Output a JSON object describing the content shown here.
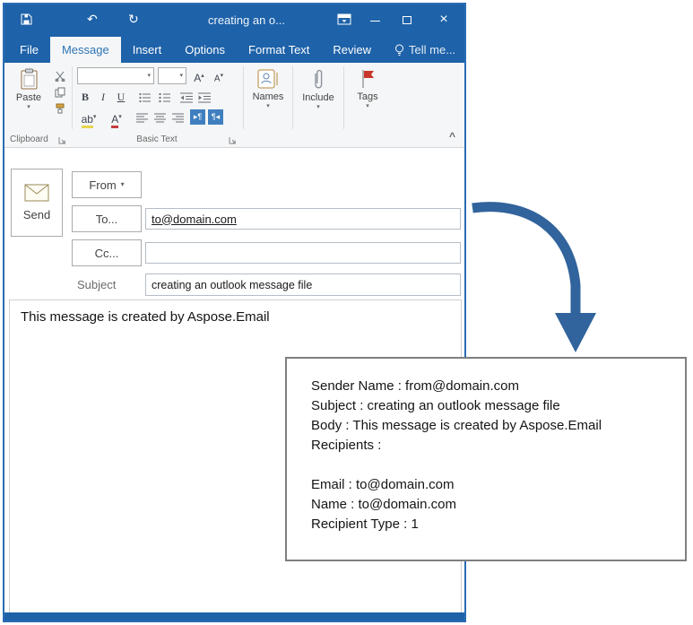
{
  "titlebar": {
    "title": "creating an o..."
  },
  "glyphs": {
    "undo": "↶",
    "redo": "↻",
    "close": "×",
    "dropdown": "▾",
    "collapse": "^",
    "bold": "B",
    "italic": "I",
    "underline": "U",
    "grow_font": "A",
    "grow_caret": "▴",
    "shrink_font": "A",
    "shrink_caret": "▾",
    "highlight": "ab",
    "font_color": "A",
    "dir_ltr": "▸¶",
    "dir_rtl": "¶◂"
  },
  "tabs": [
    {
      "label": "File",
      "active": false
    },
    {
      "label": "Message",
      "active": true
    },
    {
      "label": "Insert",
      "active": false
    },
    {
      "label": "Options",
      "active": false
    },
    {
      "label": "Format Text",
      "active": false
    },
    {
      "label": "Review",
      "active": false
    },
    {
      "label": "Tell me...",
      "active": false
    }
  ],
  "ribbon": {
    "paste": "Paste",
    "clipboard_group": "Clipboard",
    "basic_text_group": "Basic Text",
    "names": "Names",
    "include": "Include",
    "tags": "Tags",
    "font_value": "",
    "font_size_value": ""
  },
  "compose": {
    "send": "Send",
    "from": "From",
    "to": "To...",
    "cc": "Cc...",
    "subject_label": "Subject",
    "to_value": "to@domain.com",
    "cc_value": "",
    "subject_value": "creating an outlook message file",
    "body": "This message is created by Aspose.Email"
  },
  "info_box": {
    "lines": [
      "Sender Name : from@domain.com",
      "Subject : creating an outlook message file",
      "Body : This message is created by Aspose.Email",
      "Recipients :",
      "",
      "Email : to@domain.com",
      "Name : to@domain.com",
      "Recipient Type : 1"
    ]
  },
  "colors": {
    "title_bar": "#1e62a9",
    "accent": "#2e75b5",
    "arrow": "#31639c",
    "flag_red": "#c9372c"
  }
}
